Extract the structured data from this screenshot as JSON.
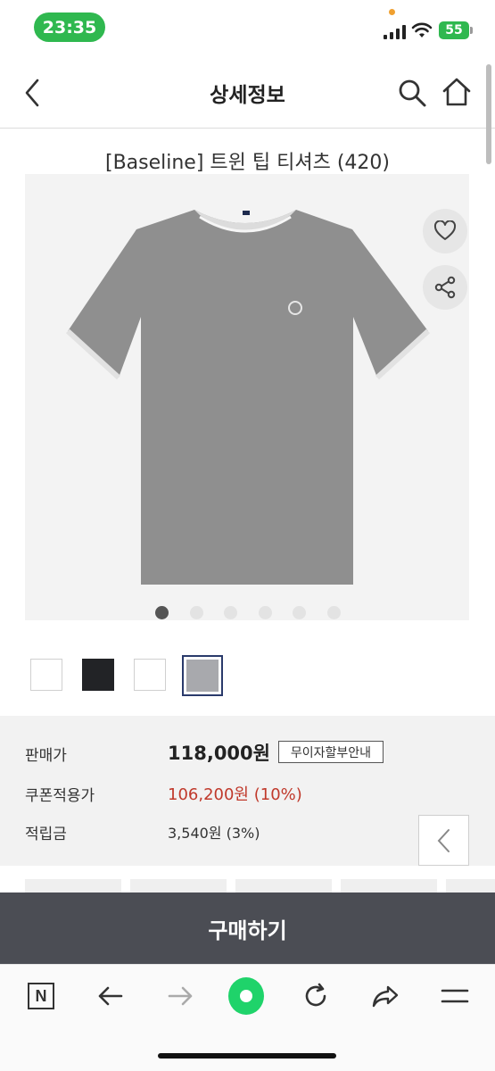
{
  "status_bar": {
    "time": "23:35",
    "battery": "55"
  },
  "header": {
    "title": "상세정보"
  },
  "product": {
    "name": "[Baseline] 트윈 팁 티셔츠 (420)"
  },
  "gallery": {
    "dot_count": 6,
    "active_index": 0
  },
  "swatches": [
    {
      "name": "white",
      "color": "#ffffff"
    },
    {
      "name": "black",
      "color": "#222326"
    },
    {
      "name": "white",
      "color": "#ffffff"
    },
    {
      "name": "grey",
      "color": "#a8a9ad"
    }
  ],
  "price_info": {
    "price_label": "판매가",
    "price_value": "118,000원",
    "installment_label": "무이자할부안내",
    "coupon_label": "쿠폰적용가",
    "coupon_value": "106,200원 (10%)",
    "points_label": "적립금",
    "points_value": "3,540원 (3%)"
  },
  "buy_button": {
    "label": "구매하기"
  },
  "colors": {
    "accent_green": "#2fb84f",
    "buy_bar": "#4b4d54",
    "coupon_red": "#c0392b",
    "naver_green": "#1fd36a"
  },
  "browser_nav": {
    "icons": [
      "naver-n-icon",
      "back-arrow-icon",
      "forward-arrow-icon",
      "green-home-icon",
      "refresh-icon",
      "share-icon",
      "menu-icon"
    ],
    "n_label": "N"
  }
}
